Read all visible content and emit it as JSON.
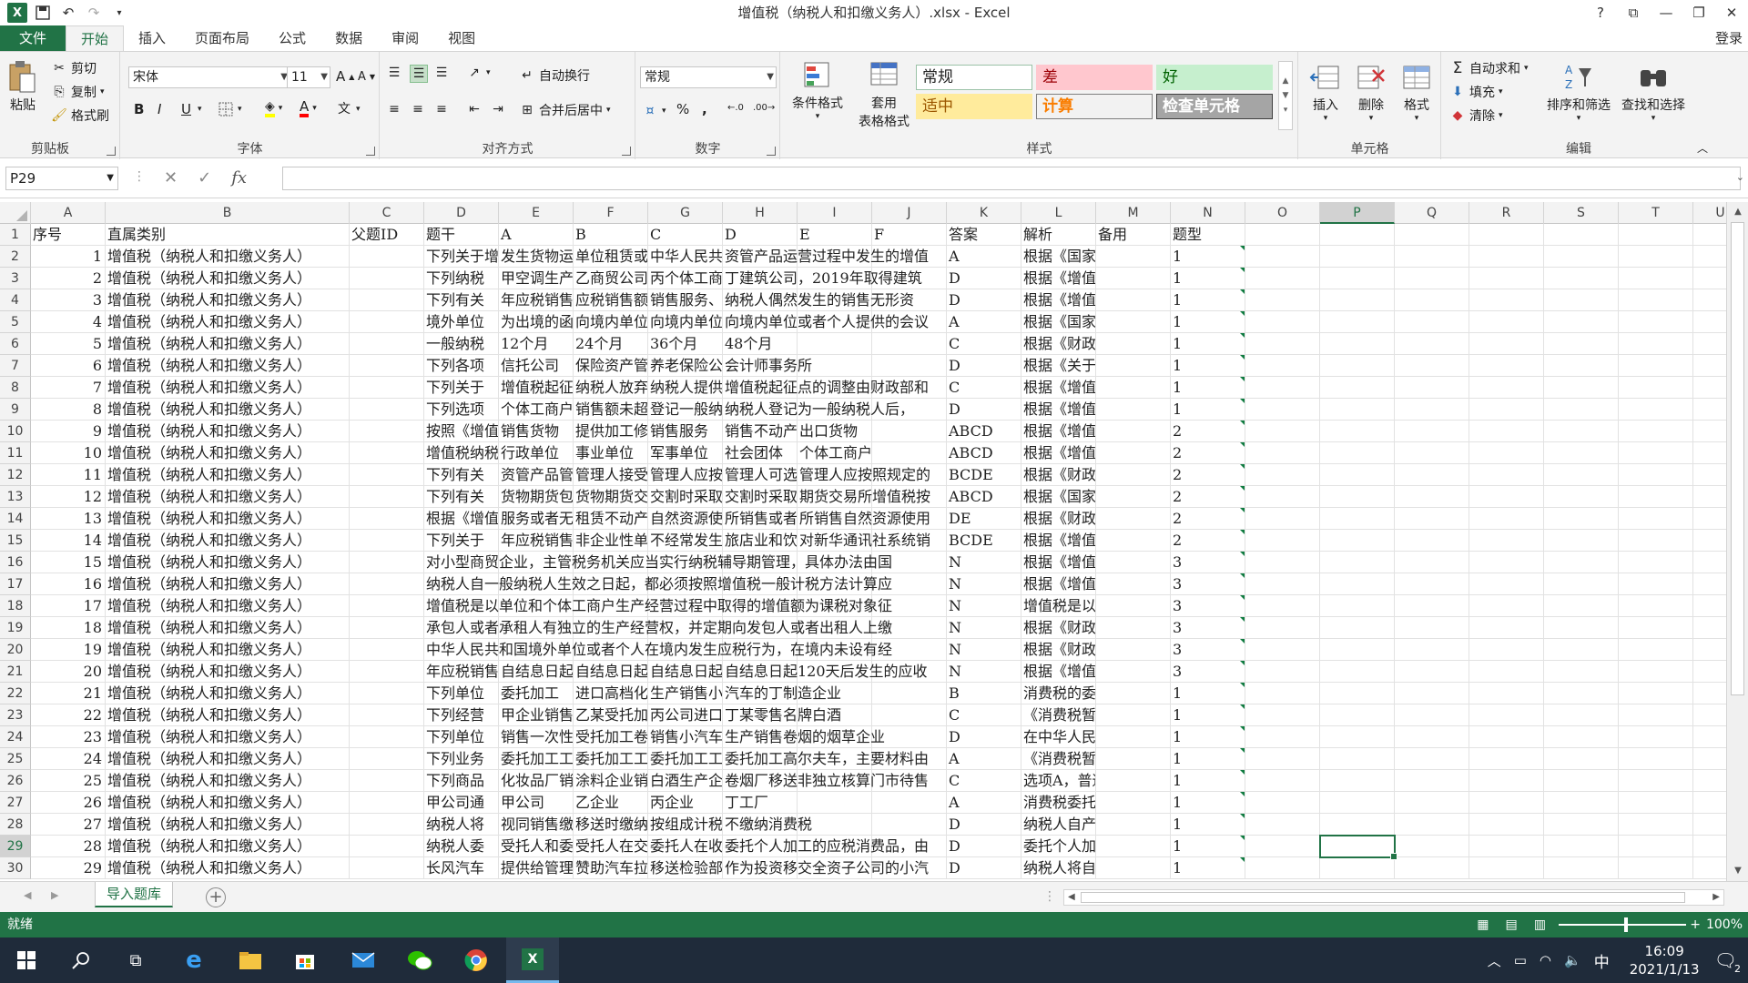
{
  "window": {
    "title": "增值税（纳税人和扣缴义务人）.xlsx - Excel",
    "controls": [
      "?",
      "⧉",
      "—",
      "❐",
      "✕"
    ]
  },
  "tabs": [
    "文件",
    "开始",
    "插入",
    "页面布局",
    "公式",
    "数据",
    "审阅",
    "视图"
  ],
  "active_tab": "开始",
  "login": "登录",
  "ribbon": {
    "clipboard": {
      "label": "剪贴板",
      "paste": "粘贴",
      "cut": "剪切",
      "copy": "复制",
      "format_painter": "格式刷"
    },
    "font": {
      "label": "字体",
      "name": "宋体",
      "size": "11",
      "bold": "B",
      "italic": "I",
      "underline": "U"
    },
    "alignment": {
      "label": "对齐方式",
      "wrap": "自动换行",
      "merge": "合并后居中"
    },
    "number": {
      "label": "数字",
      "format": "常规"
    },
    "styles": {
      "label": "样式",
      "conditional": "条件格式",
      "table_format": [
        "套用",
        "表格格式"
      ],
      "cells": [
        {
          "text": "常规",
          "bg": "#ffffff",
          "fg": "#222222",
          "border": "#9bc2a7"
        },
        {
          "text": "差",
          "bg": "#ffc7ce",
          "fg": "#9c0006",
          "border": "#ffc7ce"
        },
        {
          "text": "好",
          "bg": "#c6efce",
          "fg": "#006100",
          "border": "#c6efce"
        },
        {
          "text": "适中",
          "bg": "#ffeb9c",
          "fg": "#9c5700",
          "border": "#ffeb9c"
        },
        {
          "text": "计算",
          "bg": "#f2f2f2",
          "fg": "#fa7d00",
          "border": "#7f7f7f"
        },
        {
          "text": "检查单元格",
          "bg": "#a5a5a5",
          "fg": "#ffffff",
          "border": "#3f3f3f"
        }
      ]
    },
    "cells": {
      "label": "单元格",
      "insert": "插入",
      "delete": "删除",
      "format": "格式"
    },
    "editing": {
      "label": "编辑",
      "autosum": "自动求和",
      "fill": "填充",
      "clear": "清除",
      "sort": "排序和筛选",
      "find": "查找和选择"
    }
  },
  "name_box": "P29",
  "formula": "",
  "columns": [
    "A",
    "B",
    "C",
    "D",
    "E",
    "F",
    "G",
    "H",
    "I",
    "J",
    "K",
    "L",
    "M",
    "N",
    "O",
    "P",
    "Q",
    "R",
    "S",
    "T",
    "U"
  ],
  "selected_col": "P",
  "selected_row": "29",
  "rows": [
    {
      "n": "1",
      "A": "序号",
      "B": "直属类别",
      "C": "父题ID",
      "D": "题干",
      "E": "A",
      "F": "B",
      "G": "C",
      "H": "D",
      "I": "E",
      "J": "F",
      "K": "答案",
      "L": "解析",
      "M": "备用",
      "N": "题型"
    },
    {
      "n": "2",
      "A": "1",
      "B": "增值税（纳税人和扣缴义务人）",
      "D": "下列关于增",
      "E": "发生货物运",
      "F": "单位租赁或",
      "G": "中华人民共",
      "H": "资管产品运营过程中发生的增值",
      "K": "A",
      "L": "根据《国家税务总局",
      "N": "1"
    },
    {
      "n": "3",
      "A": "2",
      "B": "增值税（纳税人和扣缴义务人）",
      "D": "下列纳税",
      "E": "甲空调生产",
      "F": "乙商贸公司",
      "G": "丙个体工商",
      "H": "丁建筑公司，2019年取得建筑",
      "K": "D",
      "L": "根据《增值税一般纳",
      "N": "1"
    },
    {
      "n": "4",
      "A": "3",
      "B": "增值税（纳税人和扣缴义务人）",
      "D": "下列有关",
      "E": "年应税销售",
      "F": "应税销售额",
      "G": "销售服务、",
      "H": "纳税人偶然发生的销售无形资",
      "K": "D",
      "L": "根据《增值税一般纳",
      "N": "1"
    },
    {
      "n": "5",
      "A": "4",
      "B": "增值税（纳税人和扣缴义务人）",
      "D": "境外单位",
      "E": "为出境的函",
      "F": "向境内单位",
      "G": "向境内单位",
      "H": "向境内单位或者个人提供的会议",
      "K": "A",
      "L": "根据《国家税务总局",
      "N": "1"
    },
    {
      "n": "6",
      "A": "5",
      "B": "增值税（纳税人和扣缴义务人）",
      "D": "一般纳税",
      "E": "12个月",
      "F": "24个月",
      "G": "36个月",
      "H": "48个月",
      "K": "C",
      "L": "根据《财政部、国家",
      "N": "1"
    },
    {
      "n": "7",
      "A": "6",
      "B": "增值税（纳税人和扣缴义务人）",
      "D": "下列各项",
      "E": "信托公司",
      "F": "保险资产管",
      "G": "养老保险公",
      "H": "会计师事务所",
      "K": "D",
      "L": "根据《关于资管产品",
      "N": "1"
    },
    {
      "n": "8",
      "A": "7",
      "B": "增值税（纳税人和扣缴义务人）",
      "D": "下列关于",
      "E": "增值税起征",
      "F": "纳税人放弃",
      "G": "纳税人提供",
      "H": "增值税起征点的调整由财政部和",
      "K": "C",
      "L": "根据《增值税暂行条",
      "N": "1"
    },
    {
      "n": "9",
      "A": "8",
      "B": "增值税（纳税人和扣缴义务人）",
      "D": "下列选项",
      "E": "个体工商户",
      "F": "销售额未超",
      "G": "登记一般纳",
      "H": "纳税人登记为一般纳税人后，",
      "K": "D",
      "L": "根据《增值税一般纳",
      "N": "1"
    },
    {
      "n": "10",
      "A": "9",
      "B": "增值税（纳税人和扣缴义务人）",
      "D": "按照《增值",
      "E": "销售货物",
      "F": "提供加工修",
      "G": "销售服务",
      "H": "销售不动产",
      "I": "出口货物",
      "K": "ABCD",
      "L": "根据《增值税暂行条",
      "N": "2"
    },
    {
      "n": "11",
      "A": "10",
      "B": "增值税（纳税人和扣缴义务人）",
      "D": "增值税纳税",
      "E": "行政单位",
      "F": "事业单位",
      "G": "军事单位",
      "H": "社会团体",
      "I": "个体工商户",
      "K": "ABCD",
      "L": "根据《增值税暂行条",
      "N": "2"
    },
    {
      "n": "12",
      "A": "11",
      "B": "增值税（纳税人和扣缴义务人）",
      "D": "下列有关",
      "E": "资管产品管",
      "F": "管理人接受",
      "G": "管理人应按",
      "H": "管理人可选",
      "I": "管理人应按照规定的",
      "K": "BCDE",
      "L": "根据《财政部、国家",
      "N": "2"
    },
    {
      "n": "13",
      "A": "12",
      "B": "增值税（纳税人和扣缴义务人）",
      "D": "下列有关",
      "E": "货物期货包",
      "F": "货物期货交",
      "G": "交割时采取",
      "H": "交割时采取",
      "I": "期货交易所增值税按",
      "K": "ABCD",
      "L": "根据《国家税务总局",
      "N": "2"
    },
    {
      "n": "14",
      "A": "13",
      "B": "增值税（纳税人和扣缴义务人）",
      "D": "根据《增值",
      "E": "服务或者无",
      "F": "租赁不动产",
      "G": "自然资源使",
      "H": "所销售或者",
      "I": "所销售自然资源使用",
      "K": "DE",
      "L": "根据《财政部、国家",
      "N": "2"
    },
    {
      "n": "15",
      "A": "14",
      "B": "增值税（纳税人和扣缴义务人）",
      "D": "下列关于",
      "E": "年应税销售",
      "F": "非企业性单",
      "G": "不经常发生",
      "H": "旅店业和饮",
      "I": "对新华通讯社系统销",
      "K": "BCDE",
      "L": "根据《增值税暂行条",
      "N": "2"
    },
    {
      "n": "16",
      "A": "15",
      "B": "增值税（纳税人和扣缴义务人）",
      "D": "对小型商贸企业，主管税务机关应当实行纳税辅导期管理，具体办法由国",
      "K": "N",
      "L": "根据《增值税一般纳",
      "N": "3"
    },
    {
      "n": "17",
      "A": "16",
      "B": "增值税（纳税人和扣缴义务人）",
      "D": "纳税人自一般纳税人生效之日起，都必须按照增值税一般计税方法计算应",
      "K": "N",
      "L": "根据《增值税一般纳",
      "N": "3"
    },
    {
      "n": "18",
      "A": "17",
      "B": "增值税（纳税人和扣缴义务人）",
      "D": "增值税是以单位和个体工商户生产经营过程中取得的增值额为课税对象征",
      "K": "N",
      "L": "增值税是以单位和个",
      "N": "3"
    },
    {
      "n": "19",
      "A": "18",
      "B": "增值税（纳税人和扣缴义务人）",
      "D": "承包人或者承租人有独立的生产经营权，并定期向发包人或者出租人上缴",
      "K": "N",
      "L": "根据《财政部、国家",
      "N": "3"
    },
    {
      "n": "20",
      "A": "19",
      "B": "增值税（纳税人和扣缴义务人）",
      "D": "中华人民共和国境外单位或者个人在境内发生应税行为，在境内未设有经",
      "K": "N",
      "L": "根据《财政部、国家",
      "N": "3"
    },
    {
      "n": "21",
      "A": "20",
      "B": "增值税（纳税人和扣缴义务人）",
      "D": "年应税销售",
      "E": "自结息日起",
      "F": "自结息日起",
      "G": "自结息日起",
      "H": "自结息日起120天后发生的应收",
      "K": "N",
      "L": "根据《增值税暂行条",
      "N": "3"
    },
    {
      "n": "22",
      "A": "21",
      "B": "增值税（纳税人和扣缴义务人）",
      "D": "下列单位",
      "E": "委托加工",
      "F": "进口高档化",
      "G": "生产销售小",
      "H": "汽车的丁制造企业",
      "K": "B",
      "L": "消费税的委托加工业",
      "N": "1"
    },
    {
      "n": "23",
      "A": "22",
      "B": "增值税（纳税人和扣缴义务人）",
      "D": "下列经营",
      "E": "甲企业销售",
      "F": "乙某受托加",
      "G": "丙公司进口",
      "H": "丁某零售名牌白酒",
      "K": "C",
      "L": "《消费税暂行条例》",
      "N": "1"
    },
    {
      "n": "24",
      "A": "23",
      "B": "增值税（纳税人和扣缴义务人）",
      "D": "下列单位",
      "E": "销售一次性",
      "F": "受托加工卷",
      "G": "销售小汽车",
      "H": "生产销售卷烟的烟草企业",
      "K": "D",
      "L": "在中华人民共和国境",
      "N": "1"
    },
    {
      "n": "25",
      "A": "24",
      "B": "增值税（纳税人和扣缴义务人）",
      "D": "下列业务",
      "E": "委托加工工",
      "F": "委托加工工",
      "G": "委托加工工",
      "H": "委托加工高尔夫车，主要材料由",
      "K": "A",
      "L": "《消费税暂行条例实",
      "N": "1"
    },
    {
      "n": "26",
      "A": "25",
      "B": "增值税（纳税人和扣缴义务人）",
      "D": "下列商品",
      "E": "化妆品厂销",
      "F": "涂料企业销",
      "G": "白酒生产企",
      "H": "卷烟厂移送非独立核算门市待售",
      "K": "C",
      "L": "选项A，普通香水不属",
      "N": "1"
    },
    {
      "n": "27",
      "A": "26",
      "B": "增值税（纳税人和扣缴义务人）",
      "D": "甲公司通",
      "E": "甲公司",
      "F": "乙企业",
      "G": "丙企业",
      "H": "丁工厂",
      "K": "A",
      "L": "消费税委托加工业务",
      "N": "1"
    },
    {
      "n": "28",
      "A": "27",
      "B": "增值税（纳税人和扣缴义务人）",
      "D": "纳税人将",
      "E": "视同销售缴",
      "F": "移送时缴纳",
      "G": "按组成计税",
      "H": "不缴纳消费税",
      "K": "D",
      "L": "纳税人自产自用的应",
      "N": "1"
    },
    {
      "n": "29",
      "A": "28",
      "B": "增值税（纳税人和扣缴义务人）",
      "D": "纳税人委",
      "E": "受托人和委",
      "F": "受托人在交",
      "G": "委托人在收",
      "H": "委托个人加工的应税消费品，由",
      "K": "D",
      "L": "委托个人加工的应税",
      "N": "1"
    },
    {
      "n": "30",
      "A": "29",
      "B": "增值税（纳税人和扣缴义务人）",
      "D": "长风汽车",
      "E": "提供给管理",
      "F": "赞助汽车拉",
      "G": "移送检验部",
      "H": "作为投资移交全资子公司的小汽",
      "K": "D",
      "L": "纳税人将自产自用的",
      "N": "1"
    }
  ],
  "sheet_tab": "导入题库",
  "status": {
    "ready": "就绪",
    "zoom": "100%",
    "minus": "−",
    "plus": "+"
  },
  "taskbar": {
    "time": "16:09",
    "date": "2021/1/13",
    "ime": "中",
    "notif": "2"
  }
}
